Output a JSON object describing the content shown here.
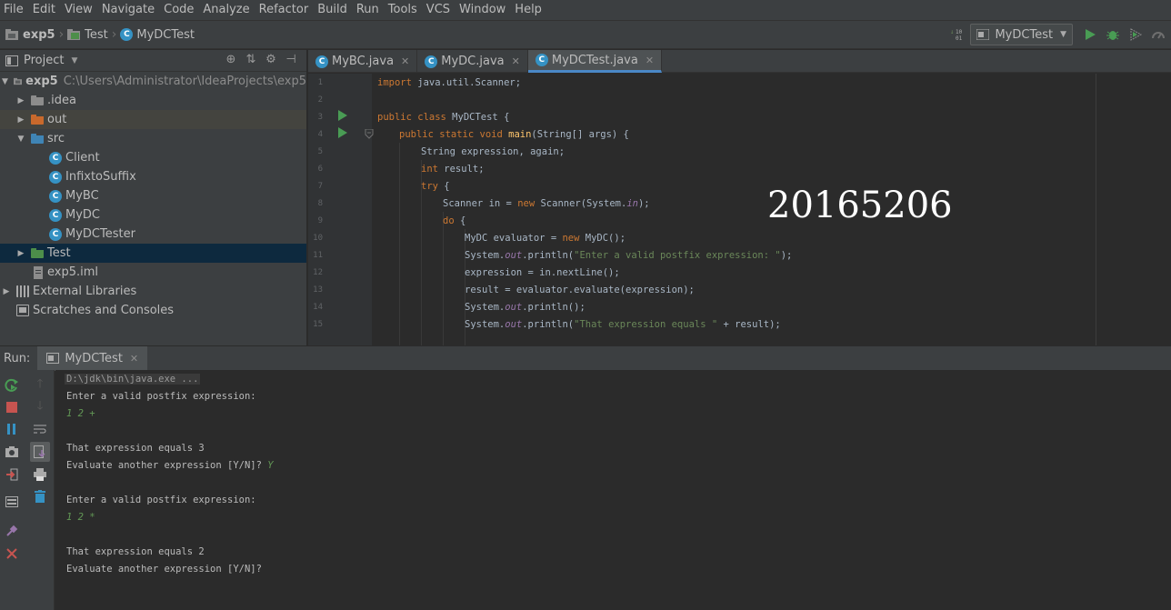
{
  "menu": [
    "File",
    "Edit",
    "View",
    "Navigate",
    "Code",
    "Analyze",
    "Refactor",
    "Build",
    "Run",
    "Tools",
    "VCS",
    "Window",
    "Help"
  ],
  "breadcrumb": [
    "exp5",
    "Test",
    "MyDCTest"
  ],
  "run_config": "MyDCTest",
  "project": {
    "title": "Project",
    "root_name": "exp5",
    "root_path": "C:\\Users\\Administrator\\IdeaProjects\\exp5",
    "items": [
      ".idea",
      "out",
      "src",
      "Client",
      "InfixtoSuffix",
      "MyBC",
      "MyDC",
      "MyDCTester",
      "Test",
      "exp5.iml",
      "External Libraries",
      "Scratches and Consoles"
    ]
  },
  "editor": {
    "tabs": [
      "MyBC.java",
      "MyDC.java",
      "MyDCTest.java"
    ],
    "line_numbers": [
      "1",
      "2",
      "3",
      "4",
      "5",
      "6",
      "7",
      "8",
      "9",
      "10",
      "11",
      "12",
      "13",
      "14",
      "15"
    ],
    "code": {
      "l1_kw": "import",
      "l1": " java.util.Scanner;",
      "l3_kw": "public class",
      "l3": " MyDCTest {",
      "l4_kw": "public static void",
      "l4_fn": " main",
      "l4": "(String[] args) {",
      "l5": "String expression, again;",
      "l6_kw": "int",
      "l6": " result;",
      "l7_kw": "try",
      "l7": " {",
      "l8_a": "Scanner in = ",
      "l8_kw": "new",
      "l8_b": " Scanner(System.",
      "l8_fld": "in",
      "l8_c": ");",
      "l9_kw": "do",
      "l9": " {",
      "l10_a": "MyDC evaluator = ",
      "l10_kw": "new",
      "l10_b": " MyDC();",
      "l11_a": "System.",
      "l11_fld": "out",
      "l11_b": ".println(",
      "l11_str": "\"Enter a valid postfix expression: \"",
      "l11_c": ");",
      "l12": "expression = in.nextLine();",
      "l13": "result = evaluator.evaluate(expression);",
      "l14_a": "System.",
      "l14_fld": "out",
      "l14_b": ".println();",
      "l15_a": "System.",
      "l15_fld": "out",
      "l15_b": ".println(",
      "l15_str": "\"That expression equals \"",
      "l15_c": " + result);"
    },
    "overlay_number": "20165206"
  },
  "run": {
    "label": "Run:",
    "tab": "MyDCTest",
    "console": {
      "cmd": "D:\\jdk\\bin\\java.exe ...",
      "p1": "Enter a valid postfix expression:",
      "in1": "1 2 +",
      "r1": "That expression equals 3",
      "q1": "Evaluate another expression [Y/N]?",
      "in_y": "Y",
      "p2": "Enter a valid postfix expression:",
      "in2": "1 2 *",
      "r2": "That expression equals 2",
      "q2": "Evaluate another expression [Y/N]?"
    }
  },
  "colors": {
    "keyword": "#cc7832",
    "string": "#6a8759",
    "field": "#9876aa",
    "function": "#ffc66d",
    "console_input": "#629755",
    "accent": "#4a88c7"
  }
}
